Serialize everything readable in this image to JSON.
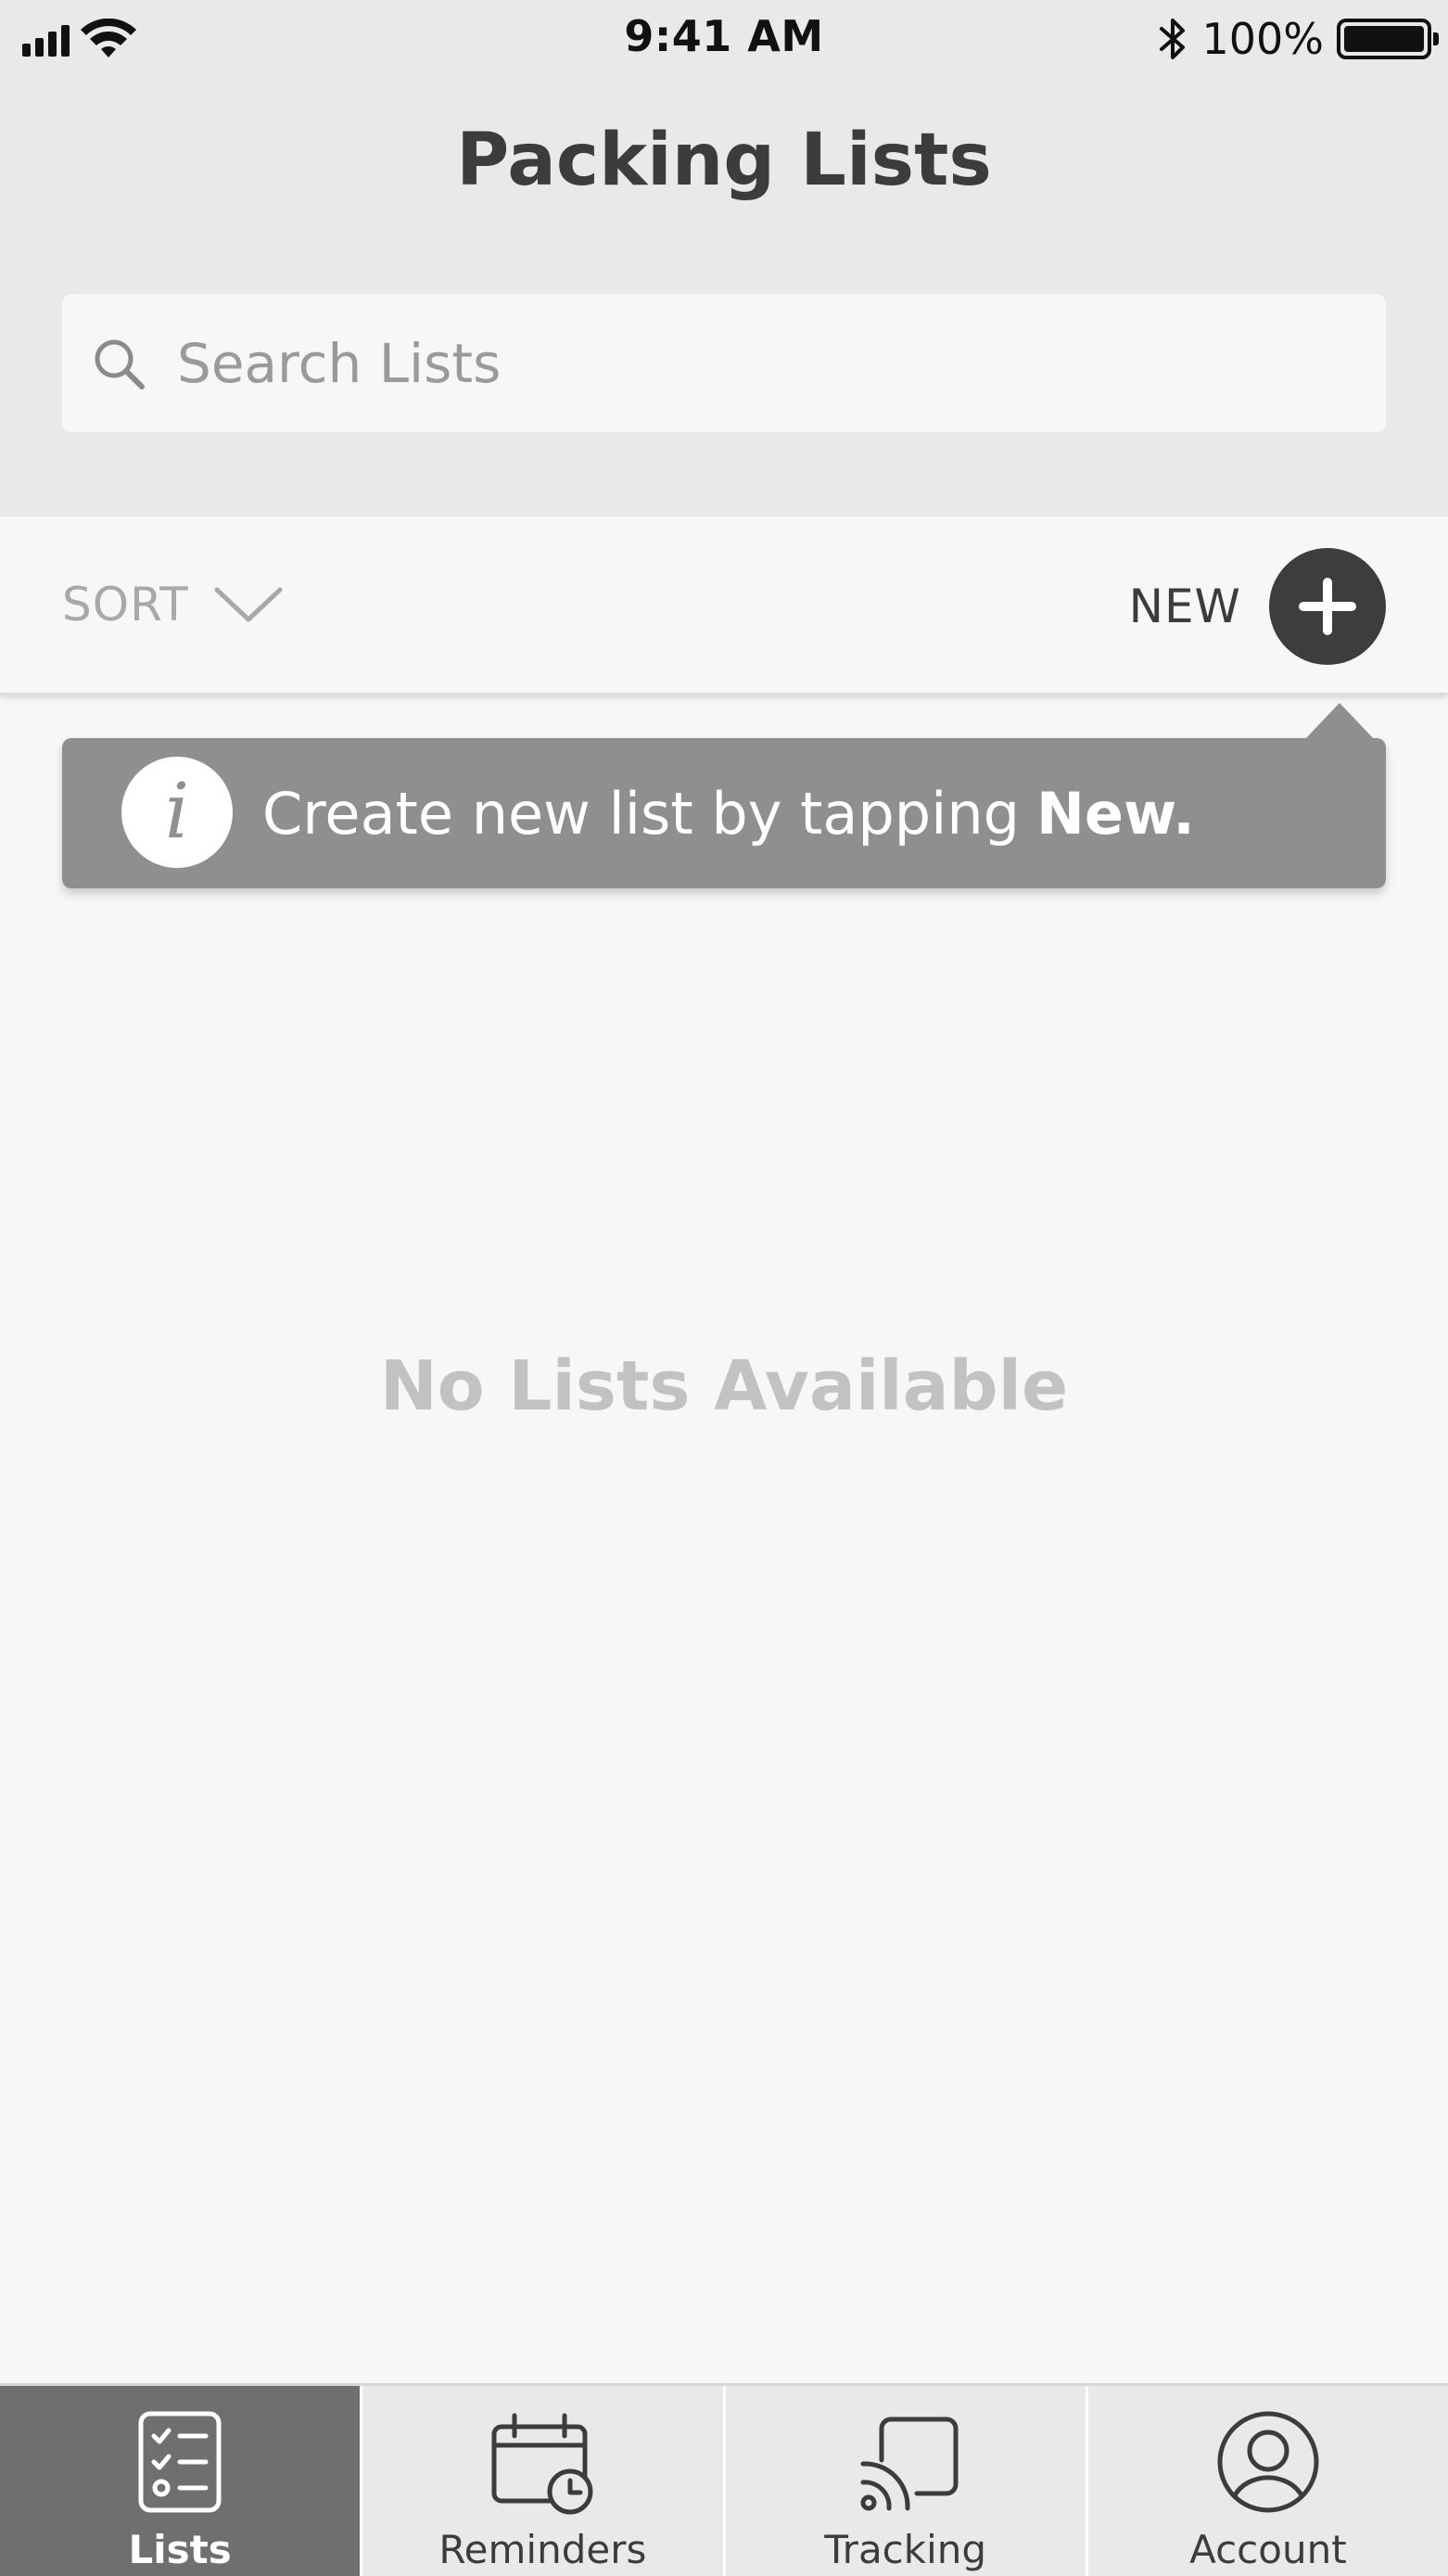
{
  "status_bar": {
    "time": "9:41 AM",
    "battery_percent": "100%",
    "icons": [
      "signal-icon",
      "wifi-icon",
      "bluetooth-icon",
      "battery-icon"
    ]
  },
  "header": {
    "title": "Packing Lists"
  },
  "search": {
    "placeholder": "Search Lists",
    "value": "",
    "icon": "search-icon"
  },
  "toolbar": {
    "sort_label": "SORT",
    "sort_icon": "chevron-down-icon",
    "new_label": "NEW",
    "new_icon": "plus-icon"
  },
  "tooltip": {
    "icon": "info-icon",
    "glyph": "i",
    "text": "Create new list by tapping",
    "emphasis": "New."
  },
  "empty_state": {
    "message": "No Lists Available"
  },
  "tabbar": {
    "active_index": 0,
    "tabs": [
      {
        "label": "Lists",
        "icon": "checklist-icon"
      },
      {
        "label": "Reminders",
        "icon": "calendar-clock-icon"
      },
      {
        "label": "Tracking",
        "icon": "cast-icon"
      },
      {
        "label": "Account",
        "icon": "user-icon"
      }
    ]
  },
  "colors": {
    "header_bg": "#e9e9e9",
    "content_bg": "#f7f7f7",
    "tooltip_bg": "#8f8f8f",
    "active_tab_bg": "#6f6f6f",
    "primary_dark": "#3d3d3d",
    "muted_text": "#c2c2c2"
  }
}
